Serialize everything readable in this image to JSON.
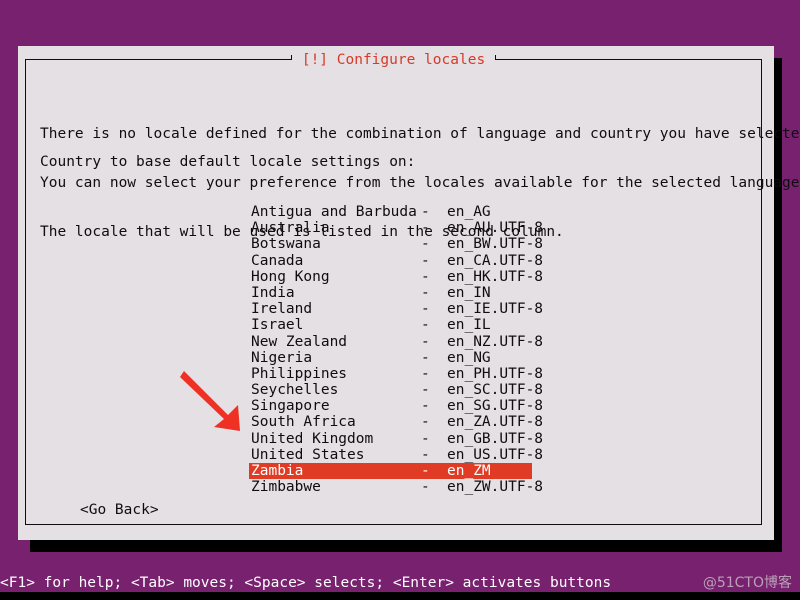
{
  "screen": {
    "background_color": "#77216F",
    "status_bar_color": "#77216F"
  },
  "dialog": {
    "title": "[!] Configure locales",
    "title_color": "#d63a28",
    "background_color": "#e4e0e4",
    "border_color": "#100d10",
    "intro_lines": [
      "There is no locale defined for the combination of language and country you have selected.",
      "You can now select your preference from the locales available for the selected language.",
      "The locale that will be used is listed in the second column."
    ],
    "prompt": "Country to base default locale settings on:",
    "go_back_label": "<Go Back>"
  },
  "locale_list": {
    "separator": "-",
    "selected_index": 16,
    "highlight_color": "#e03b24",
    "highlight_text_color": "#ffffff",
    "rows": [
      {
        "country": "Antigua and Barbuda",
        "code": "en_AG"
      },
      {
        "country": "Australia",
        "code": "en_AU.UTF-8"
      },
      {
        "country": "Botswana",
        "code": "en_BW.UTF-8"
      },
      {
        "country": "Canada",
        "code": "en_CA.UTF-8"
      },
      {
        "country": "Hong Kong",
        "code": "en_HK.UTF-8"
      },
      {
        "country": "India",
        "code": "en_IN"
      },
      {
        "country": "Ireland",
        "code": "en_IE.UTF-8"
      },
      {
        "country": "Israel",
        "code": "en_IL"
      },
      {
        "country": "New Zealand",
        "code": "en_NZ.UTF-8"
      },
      {
        "country": "Nigeria",
        "code": "en_NG"
      },
      {
        "country": "Philippines",
        "code": "en_PH.UTF-8"
      },
      {
        "country": "Seychelles",
        "code": "en_SC.UTF-8"
      },
      {
        "country": "Singapore",
        "code": "en_SG.UTF-8"
      },
      {
        "country": "South Africa",
        "code": "en_ZA.UTF-8"
      },
      {
        "country": "United Kingdom",
        "code": "en_GB.UTF-8"
      },
      {
        "country": "United States",
        "code": "en_US.UTF-8"
      },
      {
        "country": "Zambia",
        "code": "en_ZM"
      },
      {
        "country": "Zimbabwe",
        "code": "en_ZW.UTF-8"
      }
    ]
  },
  "annotation": {
    "arrow_color": "#ee3124",
    "points_at": "United States"
  },
  "status_bar": {
    "text": "<F1> for help; <Tab> moves; <Space> selects; <Enter> activates buttons",
    "watermark": "@51CTO博客"
  }
}
